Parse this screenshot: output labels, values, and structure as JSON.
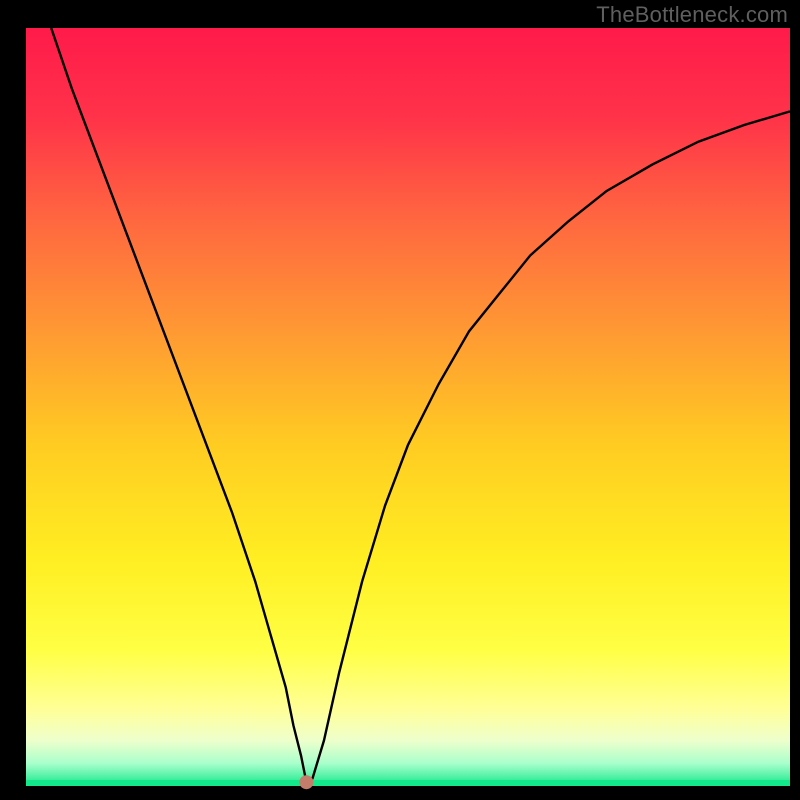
{
  "watermark": "TheBottleneck.com",
  "colors": {
    "curve": "#000000",
    "marker": "#c47d6b",
    "frame": "#000000"
  },
  "chart_data": {
    "type": "line",
    "title": "",
    "xlabel": "",
    "ylabel": "",
    "xlim": [
      0,
      100
    ],
    "ylim": [
      0,
      100
    ],
    "grid": false,
    "legend": false,
    "gradient_stops": [
      {
        "offset": 0.0,
        "color": "#ff1a4a"
      },
      {
        "offset": 0.12,
        "color": "#ff3349"
      },
      {
        "offset": 0.25,
        "color": "#ff6640"
      },
      {
        "offset": 0.4,
        "color": "#ff9933"
      },
      {
        "offset": 0.55,
        "color": "#ffcc22"
      },
      {
        "offset": 0.7,
        "color": "#ffee22"
      },
      {
        "offset": 0.82,
        "color": "#ffff44"
      },
      {
        "offset": 0.9,
        "color": "#ffff99"
      },
      {
        "offset": 0.94,
        "color": "#eeffcc"
      },
      {
        "offset": 0.97,
        "color": "#aaffcc"
      },
      {
        "offset": 1.0,
        "color": "#13e88a"
      }
    ],
    "series": [
      {
        "name": "bottleneck-curve",
        "x": [
          3.3,
          6,
          9,
          12,
          15,
          18,
          21,
          24,
          27,
          30,
          32,
          34,
          35,
          36,
          36.7,
          37.5,
          39,
          41,
          44,
          47,
          50,
          54,
          58,
          62,
          66,
          71,
          76,
          82,
          88,
          94,
          100
        ],
        "y": [
          100,
          92,
          84,
          76,
          68,
          60,
          52,
          44,
          36,
          27,
          20,
          13,
          8,
          4,
          0.5,
          1,
          6,
          15,
          27,
          37,
          45,
          53,
          60,
          65,
          70,
          74.5,
          78.5,
          82,
          85,
          87.2,
          89
        ]
      }
    ],
    "marker": {
      "x": 36.7,
      "y": 0.5,
      "r": 0.9
    }
  }
}
